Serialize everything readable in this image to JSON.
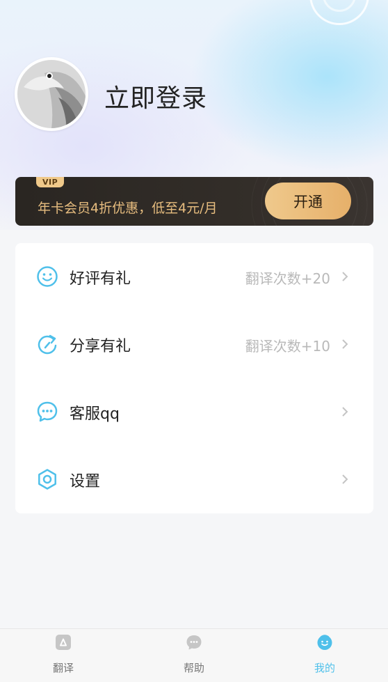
{
  "profile": {
    "login_label": "立即登录"
  },
  "vip": {
    "badge": "VIP",
    "promo_text": "年卡会员4折优惠，低至4元/月",
    "open_button": "开通",
    "colors": {
      "banner": "#2a2622",
      "gold": "#e7bd7f"
    }
  },
  "menu": {
    "items": [
      {
        "label": "好评有礼",
        "hint": "翻译次数+20",
        "icon": "smile-icon"
      },
      {
        "label": "分享有礼",
        "hint": "翻译次数+10",
        "icon": "share-icon"
      },
      {
        "label": "客服qq",
        "hint": "",
        "icon": "chat-bubble-icon"
      },
      {
        "label": "设置",
        "hint": "",
        "icon": "gear-icon"
      }
    ],
    "accent_color": "#4fc0ea"
  },
  "tabbar": {
    "tabs": [
      {
        "label": "翻译",
        "icon": "translate-icon",
        "active": false
      },
      {
        "label": "帮助",
        "icon": "help-chat-icon",
        "active": false
      },
      {
        "label": "我的",
        "icon": "profile-face-icon",
        "active": true
      }
    ]
  }
}
